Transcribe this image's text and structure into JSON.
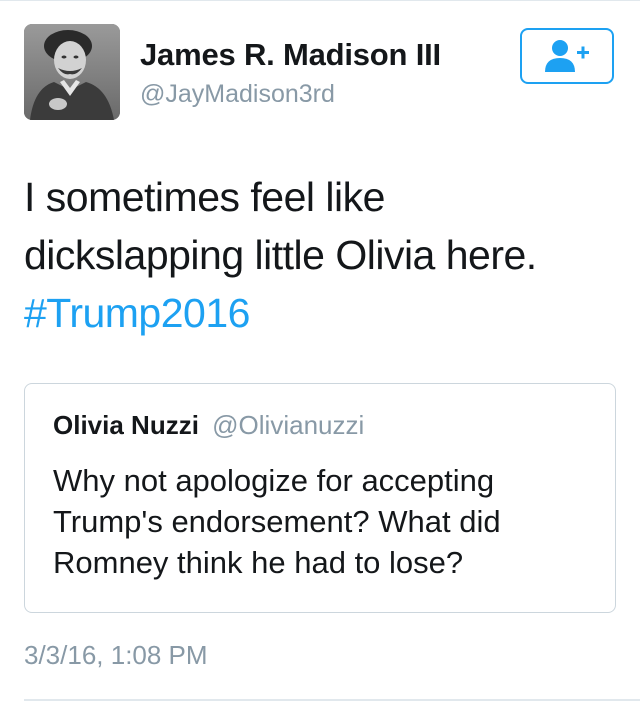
{
  "author": {
    "display_name": "James R. Madison III",
    "handle": "@JayMadison3rd",
    "avatar_icon": "portrait-photo"
  },
  "follow_button": {
    "icon": "add-user-icon",
    "color": "#1da1f2"
  },
  "tweet": {
    "text_lines": [
      "I sometimes feel like",
      "dickslapping little Olivia here."
    ],
    "hashtag": "#Trump2016",
    "timestamp": "3/3/16, 1:08 PM"
  },
  "quoted_tweet": {
    "display_name": "Olivia Nuzzi",
    "handle": "@Olivianuzzi",
    "text_lines": [
      "Why not apologize for accepting",
      "Trump's endorsement? What did",
      "Romney think he had to lose?"
    ]
  },
  "colors": {
    "link": "#1da1f2",
    "secondary_text": "#8899a6",
    "border": "#ccd6dd",
    "primary_text": "#14171a"
  }
}
